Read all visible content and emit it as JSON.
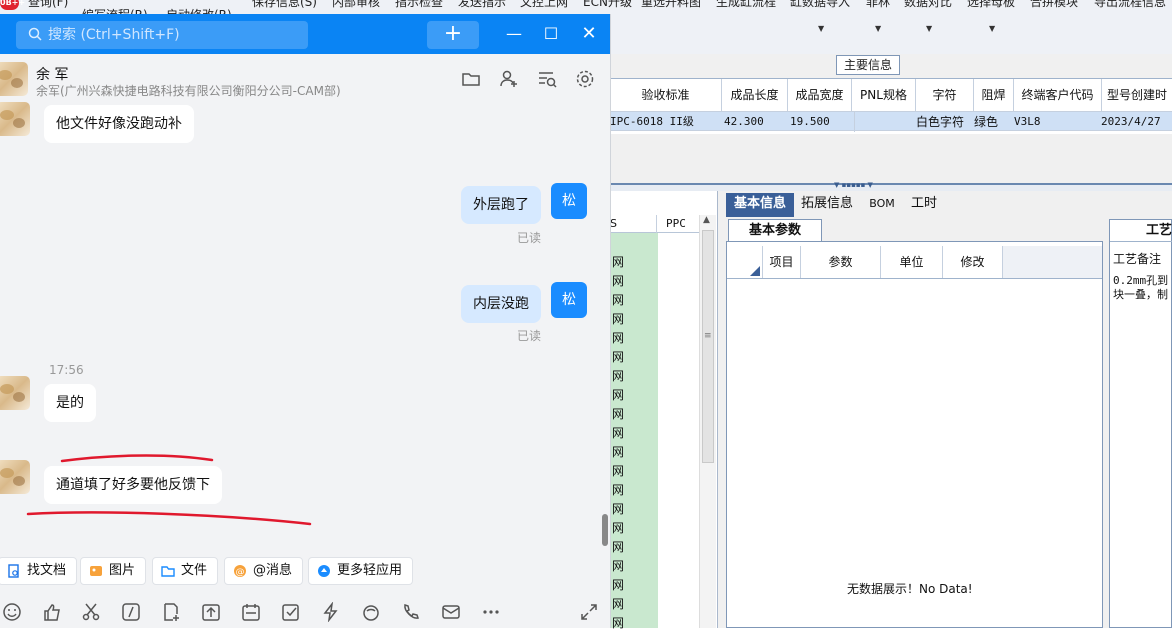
{
  "bg_app": {
    "badge": "0B++",
    "menus": [
      "查询(F)",
      "编写流程(R)",
      "启动修改(R)",
      "保存信息(S)",
      "内部审核",
      "指示检查",
      "发送指示",
      "文控上网",
      "ECN升级",
      "重选开料图",
      "生成缸流程",
      "缸数据导入",
      "菲林",
      "数据对比",
      "选择母板",
      "合拼模块",
      "导出流程信息"
    ],
    "main_info_label": "主要信息",
    "grid_headers": [
      "验收标准",
      "成品长度",
      "成品宽度",
      "PNL规格",
      "字符",
      "阻焊",
      "终端客户代码",
      "型号创建时"
    ],
    "grid_row": [
      "IPC-6018 II级",
      "42.300",
      "19.500",
      "",
      "白色字符",
      "绿色",
      "V3L8",
      "2023/4/27"
    ],
    "left_panel": {
      "col1": "S",
      "col2": "PPC",
      "cell_text": "网"
    },
    "tabs": [
      "基本信息",
      "拓展信息",
      "BOM",
      "工时"
    ],
    "subtab": "基本参数",
    "param_headers": [
      "项目",
      "参数",
      "单位",
      "修改"
    ],
    "no_data": "无数据展示！No Data!",
    "right_panel": {
      "tab": "工艺",
      "header": "工艺备注",
      "line1": "0.2mm孔到",
      "line2": "块一叠，制"
    }
  },
  "chat": {
    "search_placeholder": "搜索 (Ctrl+Shift+F)",
    "plus": "+",
    "contact": {
      "name": "余 军",
      "org": "余军(广州兴森快捷电路科技有限公司衡阳分公司-CAM部)"
    },
    "messages": [
      {
        "from": "other",
        "text": "他文件好像没跑动补"
      },
      {
        "from": "me",
        "text": "外层跑了",
        "status": "已读",
        "avatar": "松"
      },
      {
        "from": "me",
        "text": "内层没跑",
        "status": "已读",
        "avatar": "松"
      },
      {
        "time": "17:56"
      },
      {
        "from": "other",
        "text": "是的"
      },
      {
        "from": "other",
        "text": "通道填了好多要他反馈下"
      }
    ],
    "quick_actions": [
      "找文档",
      "图片",
      "文件",
      "@消息",
      "更多轻应用"
    ]
  },
  "colors": {
    "accent": "#0a84f4",
    "bubble_me": "#d6e9ff",
    "annotation": "#e0182d",
    "grid_selected": "#cfe0f5",
    "panel_green": "#c9e8cf"
  }
}
